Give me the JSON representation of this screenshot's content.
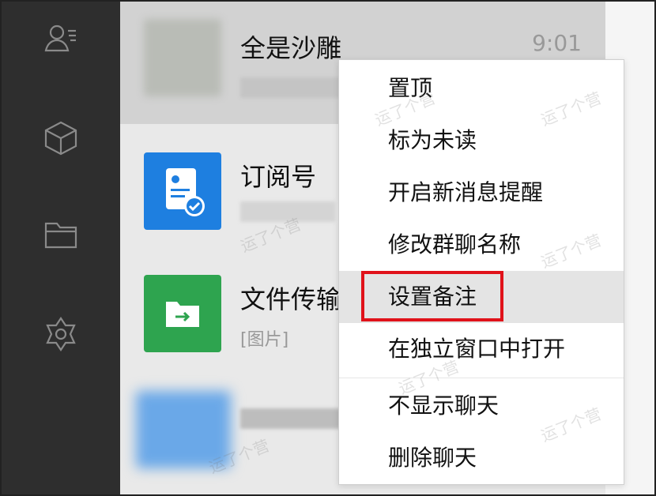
{
  "sidebar": {
    "icons": [
      "contacts-icon",
      "mini-program-icon",
      "folder-icon",
      "settings-icon"
    ]
  },
  "chats": [
    {
      "name": "全是沙雕",
      "time": "9:01",
      "preview": ""
    },
    {
      "name": "订阅号",
      "time": "",
      "preview": ""
    },
    {
      "name": "文件传输",
      "time": "",
      "preview": "[图片]"
    },
    {
      "name": "",
      "time": "",
      "preview": ""
    }
  ],
  "context_menu": {
    "items": [
      "置顶",
      "标为未读",
      "开启新消息提醒",
      "修改群聊名称",
      "设置备注",
      "在独立窗口中打开",
      "不显示聊天",
      "删除聊天"
    ],
    "hovered": "设置备注"
  },
  "watermark": "运了个营",
  "colors": {
    "sidebar_bg": "#2e2e2e",
    "subscription_avatar": "#1e7fe0",
    "file_transfer_avatar": "#2ea44f",
    "highlight_box": "#e0121a"
  }
}
